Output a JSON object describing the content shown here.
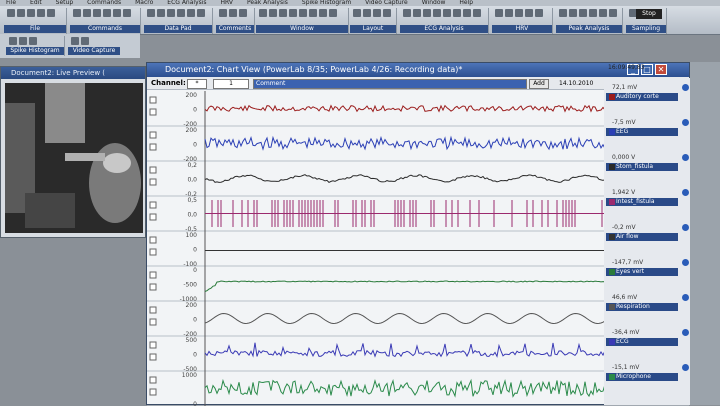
{
  "menu": [
    "File",
    "Edit",
    "Setup",
    "Commands",
    "Macro",
    "ECG Analysis",
    "HRV",
    "Peak Analysis",
    "Spike Histogram",
    "Video Capture",
    "Window",
    "Help"
  ],
  "toolbar": {
    "groups": [
      "File",
      "Commands",
      "Data Pad",
      "Comments",
      "Window",
      "Layout",
      "ECG Analysis",
      "HRV",
      "Peak Analysis",
      "Sampling"
    ],
    "second_row": [
      "Spike Histogram",
      "Video Capture"
    ],
    "stop_label": "Stop"
  },
  "preview": {
    "title": "Document2: Live Preview ("
  },
  "chart": {
    "title": "Document2: Chart View (PowerLab 8/35; PowerLab 4/26: Recording data)*",
    "channel_label": "Channel:",
    "channel_value": "*",
    "comment_number": "1",
    "comment_text": "Comment",
    "add_label": "Add",
    "date": "14.10.2010",
    "time": "16:09:49,83"
  },
  "channels": [
    {
      "value": "72,1 mV",
      "name": "Auditory corte",
      "color": "#9b1c1c",
      "yticks": [
        "200",
        "0",
        "-200"
      ]
    },
    {
      "value": "-7,5 mV",
      "name": "EEG",
      "color": "#2b3fb5",
      "yticks": [
        "200",
        "0",
        "-200"
      ]
    },
    {
      "value": "0,000 V",
      "name": "Stom_fistula",
      "color": "#2a2a2a",
      "yticks": [
        "0,2",
        "0,0",
        "-0,2"
      ]
    },
    {
      "value": "1,942 V",
      "name": "Intest_fistula",
      "color": "#9b2a6e",
      "yticks": [
        "0,5",
        "0,0",
        "-0,5"
      ]
    },
    {
      "value": "-0,2 mV",
      "name": "Air flow",
      "color": "#333333",
      "yticks": [
        "100",
        "0",
        "-100"
      ]
    },
    {
      "value": "-147,7 mV",
      "name": "Eyes vert",
      "color": "#2a7a3a",
      "yticks": [
        "0",
        "-500",
        "-1000"
      ]
    },
    {
      "value": "46,6 mV",
      "name": "Respiration",
      "color": "#555555",
      "yticks": [
        "200",
        "0",
        "-200"
      ]
    },
    {
      "value": "-36,4 mV",
      "name": "ECG",
      "color": "#3a3ab5",
      "yticks": [
        "500",
        "0",
        "-500"
      ]
    },
    {
      "value": "-15,1 mV",
      "name": "Microphone",
      "color": "#2a8a4a",
      "yticks": [
        "1000",
        "0"
      ]
    }
  ],
  "colors": {
    "titlebar": "#2c4f90",
    "panel": "#f2f4f6"
  }
}
